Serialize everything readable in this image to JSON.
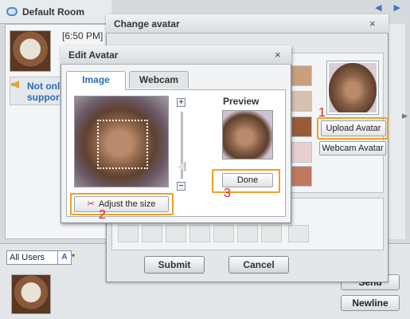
{
  "room": {
    "title": "Default Room",
    "time": "[6:50 PM]",
    "notice": "Not onl\nsuppor"
  },
  "bottom": {
    "user_filter": "All Users",
    "font_button": "A",
    "send_label": "Send",
    "newline_label": "Newline"
  },
  "change_avatar": {
    "title": "Change avatar",
    "upload_label": "Upload Avatar",
    "webcam_label": "Webcam Avatar",
    "submit_label": "Submit",
    "cancel_label": "Cancel",
    "annotation_1": "1",
    "thumb_colors": [
      "#8a5a3a",
      "#c0b0a0",
      "#e0c0b0",
      "#9a5a4a",
      "#e8d8d0",
      "#b07060"
    ]
  },
  "edit_avatar": {
    "title": "Edit Avatar",
    "tabs": [
      {
        "label": "Image"
      },
      {
        "label": "Webcam"
      }
    ],
    "preview_label": "Preview",
    "done_label": "Done",
    "adjust_label": "Adjust the size",
    "annotation_2": "2",
    "annotation_3": "3",
    "zoom_in": "+",
    "zoom_out": "−"
  },
  "icons": {
    "close": "×",
    "scissors": "✂",
    "chevron": "▾",
    "nav": "◀ ▶"
  },
  "colors": {
    "highlight": "#f0a024",
    "annotation": "#e02020",
    "tab_active": "#2c6fb6"
  }
}
